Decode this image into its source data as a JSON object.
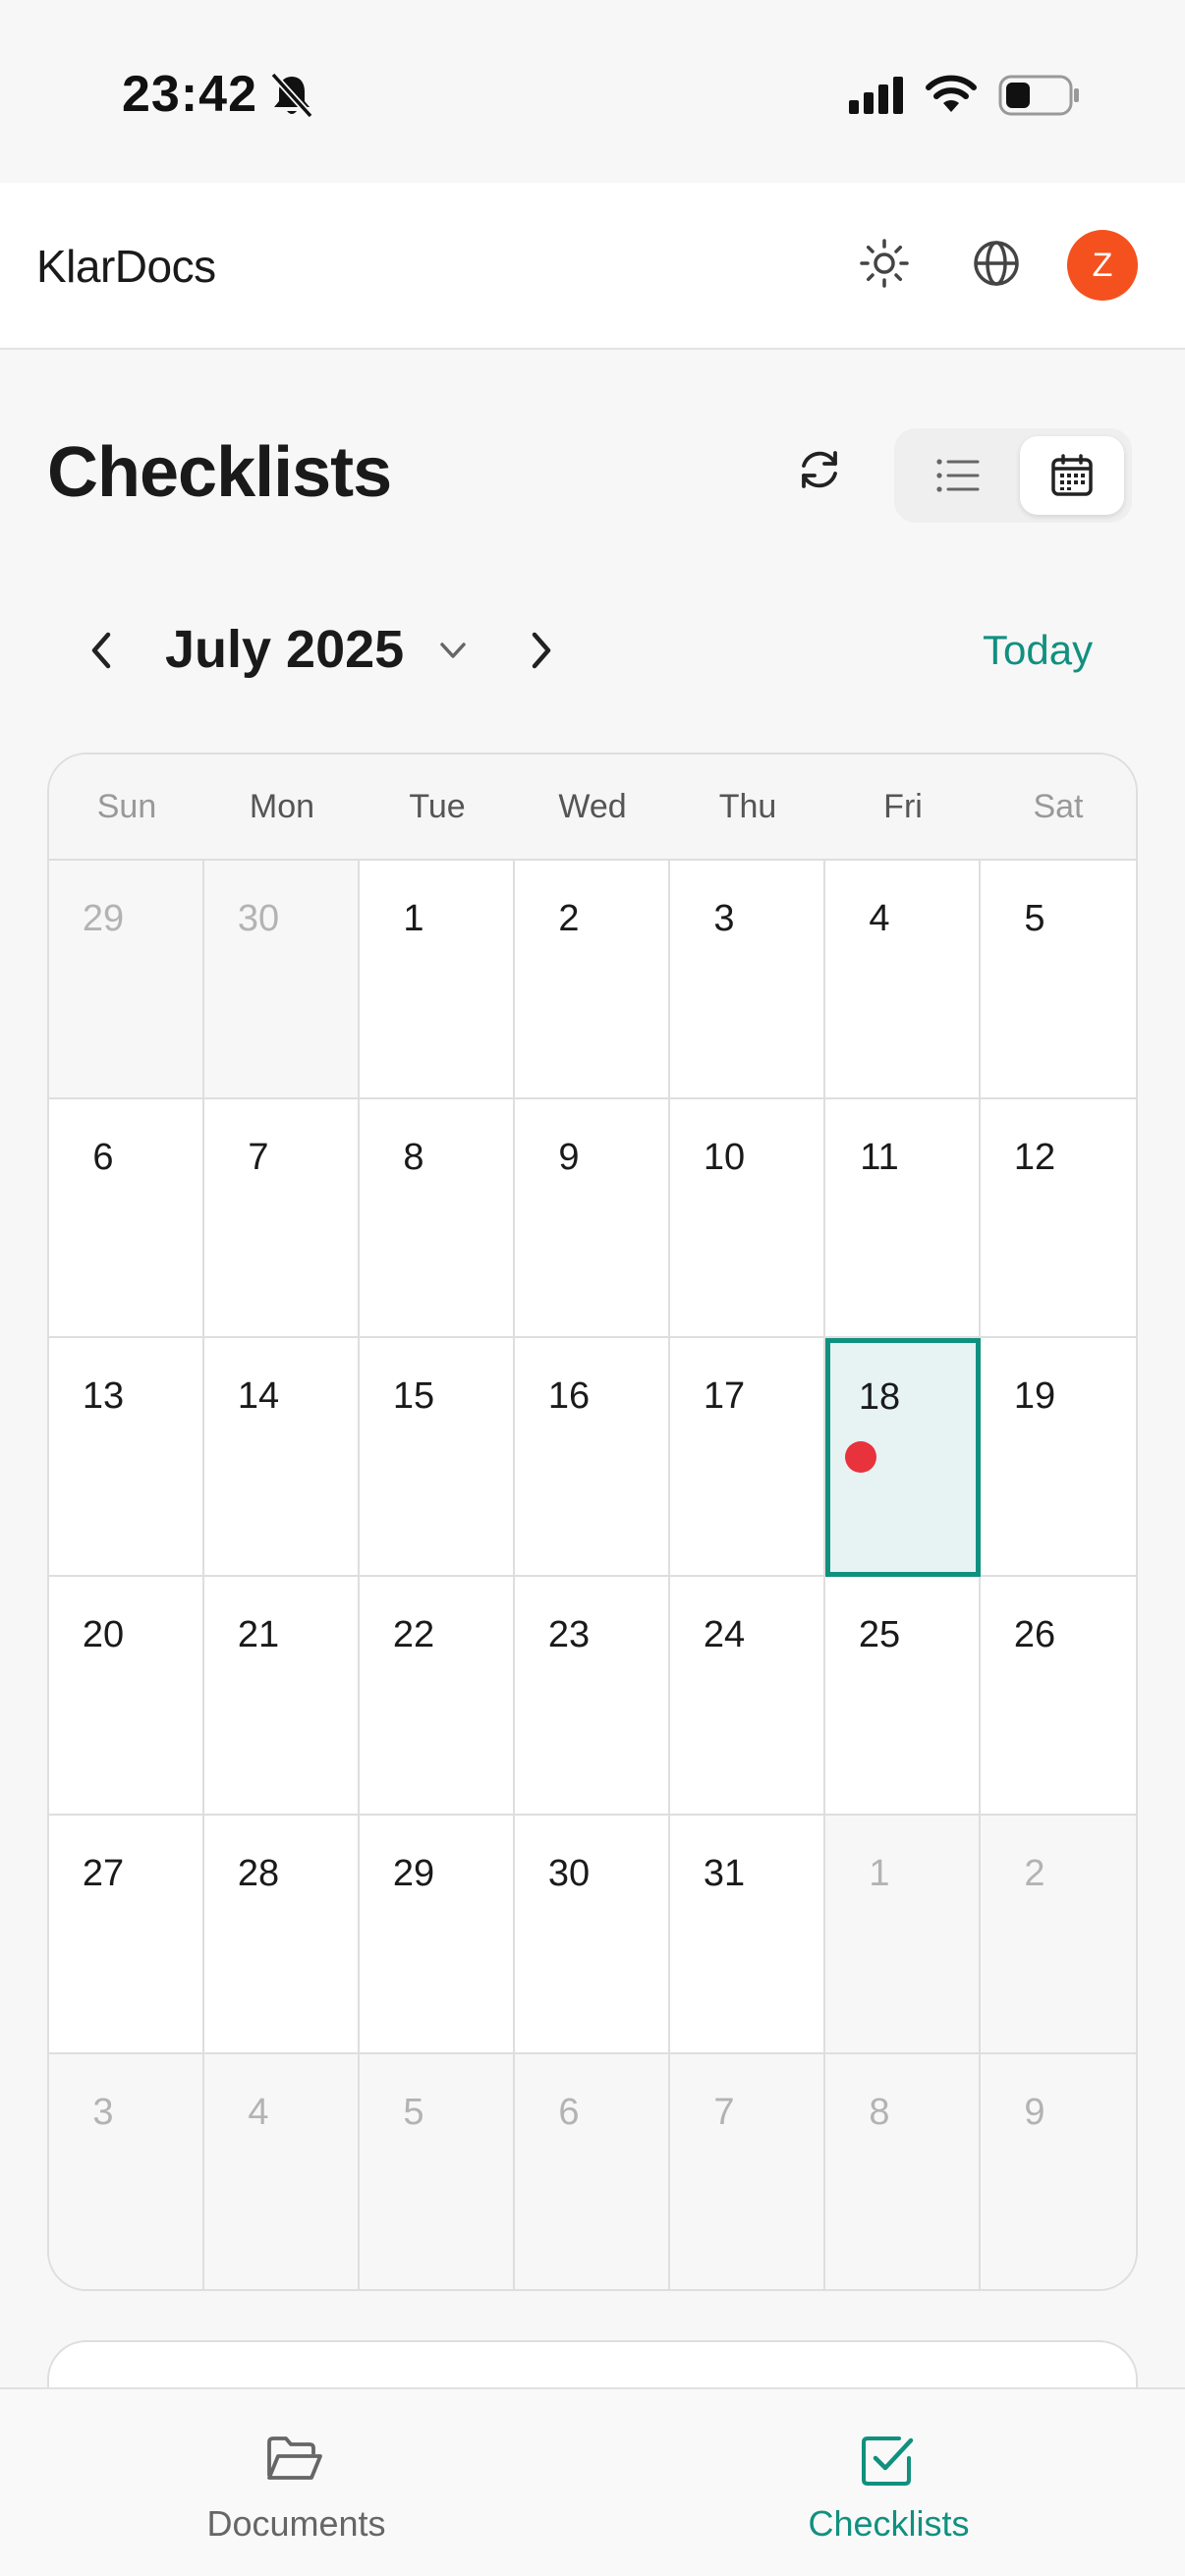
{
  "status_bar": {
    "time": "23:42"
  },
  "header": {
    "brand": "KlarDocs",
    "avatar_initial": "Z"
  },
  "page": {
    "title": "Checklists"
  },
  "calendar": {
    "month_label": "July 2025",
    "today_label": "Today",
    "weekdays": [
      "Sun",
      "Mon",
      "Tue",
      "Wed",
      "Thu",
      "Fri",
      "Sat"
    ],
    "days": [
      {
        "n": "29",
        "outside": true
      },
      {
        "n": "30",
        "outside": true
      },
      {
        "n": "1"
      },
      {
        "n": "2"
      },
      {
        "n": "3"
      },
      {
        "n": "4"
      },
      {
        "n": "5"
      },
      {
        "n": "6"
      },
      {
        "n": "7"
      },
      {
        "n": "8"
      },
      {
        "n": "9"
      },
      {
        "n": "10"
      },
      {
        "n": "11"
      },
      {
        "n": "12"
      },
      {
        "n": "13"
      },
      {
        "n": "14"
      },
      {
        "n": "15"
      },
      {
        "n": "16"
      },
      {
        "n": "17"
      },
      {
        "n": "18",
        "selected": true,
        "event": true
      },
      {
        "n": "19"
      },
      {
        "n": "20"
      },
      {
        "n": "21"
      },
      {
        "n": "22"
      },
      {
        "n": "23"
      },
      {
        "n": "24"
      },
      {
        "n": "25"
      },
      {
        "n": "26"
      },
      {
        "n": "27"
      },
      {
        "n": "28"
      },
      {
        "n": "29"
      },
      {
        "n": "30"
      },
      {
        "n": "31"
      },
      {
        "n": "1",
        "outside": true
      },
      {
        "n": "2",
        "outside": true
      },
      {
        "n": "3",
        "outside": true
      },
      {
        "n": "4",
        "outside": true
      },
      {
        "n": "5",
        "outside": true
      },
      {
        "n": "6",
        "outside": true
      },
      {
        "n": "7",
        "outside": true
      },
      {
        "n": "8",
        "outside": true
      },
      {
        "n": "9",
        "outside": true
      }
    ]
  },
  "bottom_nav": {
    "items": [
      {
        "label": "Documents",
        "icon": "folder-open-icon",
        "active": false
      },
      {
        "label": "Checklists",
        "icon": "checkbox-icon",
        "active": true
      }
    ]
  },
  "colors": {
    "accent": "#11907f",
    "avatar": "#f4511e",
    "event_dot": "#e8323c"
  }
}
